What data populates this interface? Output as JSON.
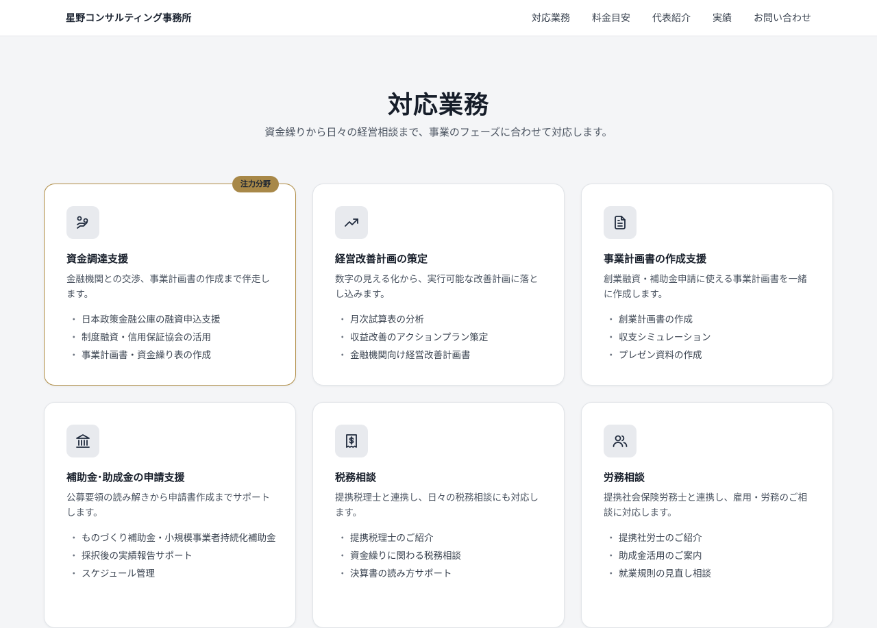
{
  "header": {
    "brand": "星野コンサルティング事務所",
    "nav": [
      "対応業務",
      "料金目安",
      "代表紹介",
      "実績",
      "お問い合わせ"
    ]
  },
  "hero": {
    "title": "対応業務",
    "subtitle": "資金繰りから日々の経営相談まで、事業のフェーズに合わせて対応します。"
  },
  "services": [
    {
      "icon": "hand-coins-icon",
      "badge": "注力分野",
      "title": "資金調達支援",
      "desc": "金融機関との交渉、事業計画書の作成まで伴走します。",
      "items": [
        "日本政策金融公庫の融資申込支援",
        "制度融資・信用保証協会の活用",
        "事業計画書・資金繰り表の作成"
      ]
    },
    {
      "icon": "trending-up-icon",
      "title": "経営改善計画の策定",
      "desc": "数字の見える化から、実行可能な改善計画に落とし込みます。",
      "items": [
        "月次試算表の分析",
        "収益改善のアクションプラン策定",
        "金融機関向け経営改善計画書"
      ]
    },
    {
      "icon": "document-icon",
      "title": "事業計画書の作成支援",
      "desc": "創業融資・補助金申請に使える事業計画書を一緒に作成します。",
      "items": [
        "創業計画書の作成",
        "収支シミュレーション",
        "プレゼン資料の作成"
      ]
    },
    {
      "icon": "bank-icon",
      "title": "補助金･助成金の申請支援",
      "desc": "公募要領の読み解きから申請書作成までサポートします。",
      "items": [
        "ものづくり補助金・小規模事業者持続化補助金",
        "採択後の実績報告サポート",
        "スケジュール管理"
      ]
    },
    {
      "icon": "receipt-dollar-icon",
      "title": "税務相談",
      "desc": "提携税理士と連携し、日々の税務相談にも対応します。",
      "items": [
        "提携税理士のご紹介",
        "資金繰りに関わる税務相談",
        "決算書の読み方サポート"
      ]
    },
    {
      "icon": "users-icon",
      "title": "労務相談",
      "desc": "提携社会保険労務士と連携し、雇用・労務のご相談に対応します。",
      "items": [
        "提携社労士のご紹介",
        "助成金活用のご案内",
        "就業規則の見直し相談"
      ]
    }
  ],
  "colors": {
    "accent": "#a88848",
    "featured_border": "#b08d45",
    "background": "#f4f5f7"
  }
}
